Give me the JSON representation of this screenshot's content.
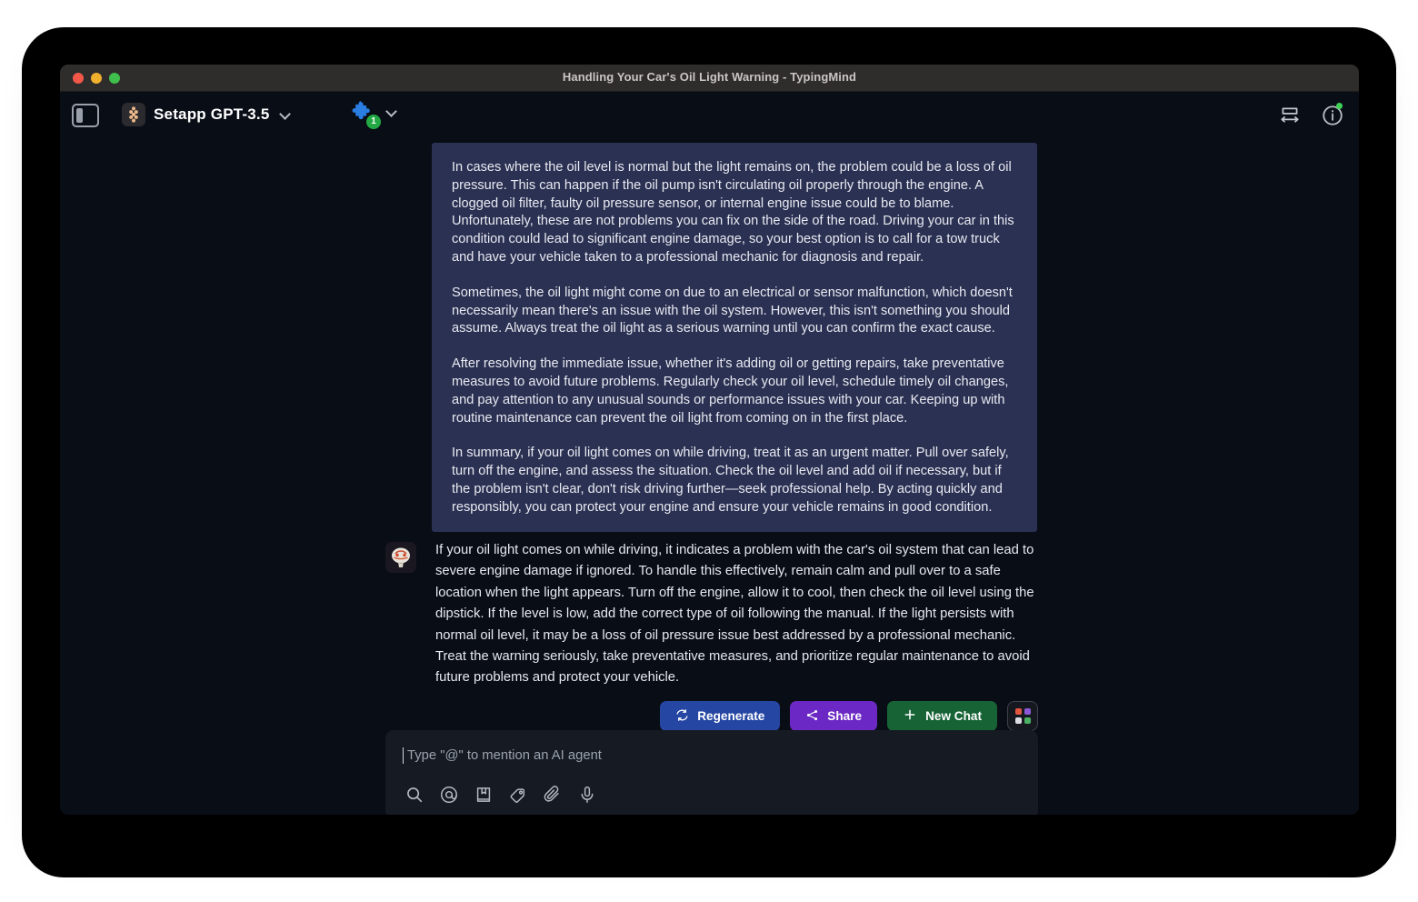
{
  "window": {
    "title": "Handling Your Car's Oil Light Warning - TypingMind",
    "traffic_lights": [
      "close-red",
      "minimize-yellow",
      "zoom-green"
    ]
  },
  "toolbar": {
    "sidebar_toggle_icon": "sidebar-panel-icon",
    "model": {
      "logo_icon": "setapp-logo-icon",
      "name": "Setapp GPT-3.5",
      "chevron_icon": "chevron-down-icon"
    },
    "plugin": {
      "icon": "puzzle-piece-icon",
      "badge_count": "1",
      "chevron_icon": "chevron-down-icon"
    },
    "right_icons": [
      {
        "name": "resize-width-icon"
      },
      {
        "name": "info-circle-icon",
        "status_dot_color": "#3fd155"
      }
    ]
  },
  "conversation": {
    "assistant_bubble": {
      "paragraphs": [
        "In cases where the oil level is normal but the light remains on, the problem could be a loss of oil pressure. This can happen if the oil pump isn't circulating oil properly through the engine. A clogged oil filter, faulty oil pressure sensor, or internal engine issue could be to blame. Unfortunately, these are not problems you can fix on the side of the road. Driving your car in this condition could lead to significant engine damage, so your best option is to call for a tow truck and have your vehicle taken to a professional mechanic for diagnosis and repair.",
        "Sometimes, the oil light might come on due to an electrical or sensor malfunction, which doesn't necessarily mean there's an issue with the oil system. However, this isn't something you should assume. Always treat the oil light as a serious warning until you can confirm the exact cause.",
        "After resolving the immediate issue, whether it's adding oil or getting repairs, take preventative measures to avoid future problems. Regularly check your oil level, schedule timely oil changes, and pay attention to any unusual sounds or performance issues with your car. Keeping up with routine maintenance can prevent the oil light from coming on in the first place.",
        "In summary, if your oil light comes on while driving, treat it as an urgent matter. Pull over safely, turn off the engine, and assess the situation. Check the oil level and add oil if necessary, but if the problem isn't clear, don't risk driving further—seek professional help. By acting quickly and responsibly, you can protect your engine and ensure your vehicle remains in good condition."
      ]
    },
    "summary_message": {
      "avatar_icon": "brain-avatar-icon",
      "text": "If your oil light comes on while driving, it indicates a problem with the car's oil system that can lead to severe engine damage if ignored. To handle this effectively, remain calm and pull over to a safe location when the light appears. Turn off the engine, allow it to cool, then check the oil level using the dipstick. If the level is low, add the correct type of oil following the manual. If the light persists with normal oil level, it may be a loss of oil pressure issue best addressed by a professional mechanic. Treat the warning seriously, take preventative measures, and prioritize regular maintenance to avoid future problems and protect your vehicle."
    }
  },
  "actions": {
    "regenerate": {
      "label": "Regenerate",
      "icon": "refresh-icon",
      "color": "#2546a3"
    },
    "share": {
      "label": "Share",
      "icon": "share-nodes-icon",
      "color": "#6b28c4"
    },
    "new_chat": {
      "label": "New Chat",
      "icon": "plus-icon",
      "color": "#176336"
    },
    "grid": {
      "icon": "apps-grid-icon",
      "colors": [
        "#e2553f",
        "#8b59d6",
        "#dcdde2",
        "#4caf63"
      ]
    }
  },
  "composer": {
    "placeholder": "Type \"@\" to mention an AI agent",
    "value": "",
    "tools": [
      {
        "name": "search-icon"
      },
      {
        "name": "mention-at-icon"
      },
      {
        "name": "prompt-library-book-icon"
      },
      {
        "name": "tag-pen-icon"
      },
      {
        "name": "attach-paperclip-icon"
      },
      {
        "name": "microphone-icon"
      }
    ]
  }
}
